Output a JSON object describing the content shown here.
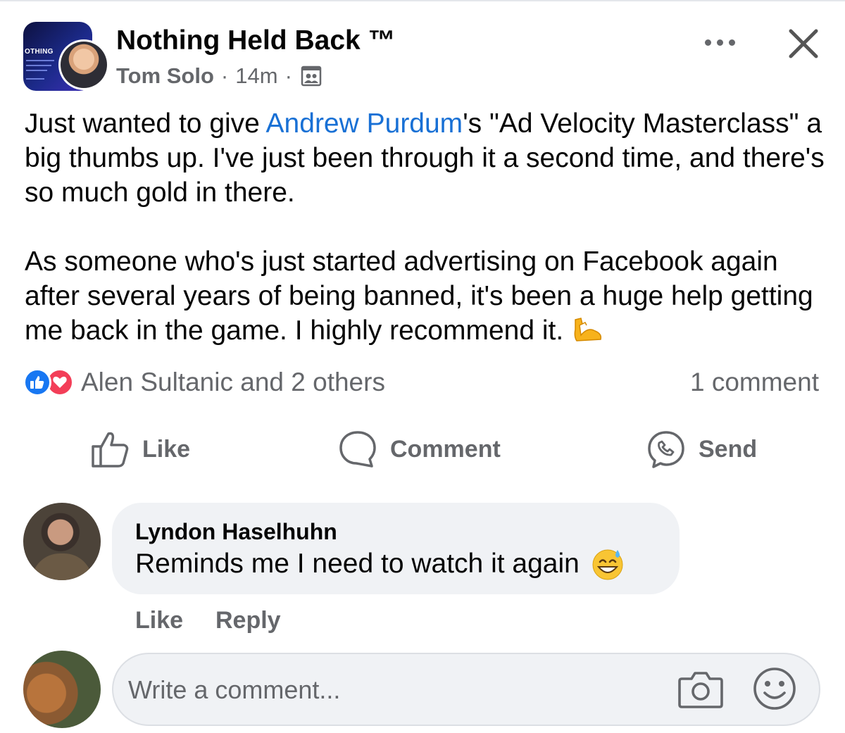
{
  "post": {
    "group_name": "Nothing Held Back ™",
    "group_thumb_text": "OTHING",
    "author": "Tom Solo",
    "time": "14m",
    "separator": "·",
    "body": {
      "p1_before": "Just wanted to give ",
      "p1_mention": "Andrew Purdum",
      "p1_after": "'s \"Ad Velocity Masterclass\" a big thumbs up. I've just been through it a second time, and there's so much gold in there.",
      "p2": "As someone who's just started advertising on Facebook again after several years of being banned, it's been a huge help getting me back in the game. I highly recommend it."
    },
    "reactions_text": "Alen Sultanic and 2 others",
    "comment_count": "1 comment"
  },
  "actions": {
    "like": "Like",
    "comment": "Comment",
    "send": "Send"
  },
  "comment": {
    "author": "Lyndon Haselhuhn",
    "text": "Reminds me I need to watch it again",
    "like": "Like",
    "reply": "Reply"
  },
  "composer": {
    "placeholder": "Write a comment..."
  },
  "colors": {
    "mention": "#1870d5",
    "like_blue": "#1877f2",
    "love_red": "#f33e58",
    "muted": "#65676b",
    "bubble": "#f0f2f5"
  },
  "icons": [
    "privacy-group-icon",
    "more-icon",
    "close-icon",
    "flexed-biceps-emoji",
    "like-reaction-icon",
    "love-reaction-icon",
    "thumbs-up-icon",
    "comment-bubble-icon",
    "messenger-send-icon",
    "sweat-smile-emoji",
    "camera-icon",
    "smiley-icon"
  ]
}
